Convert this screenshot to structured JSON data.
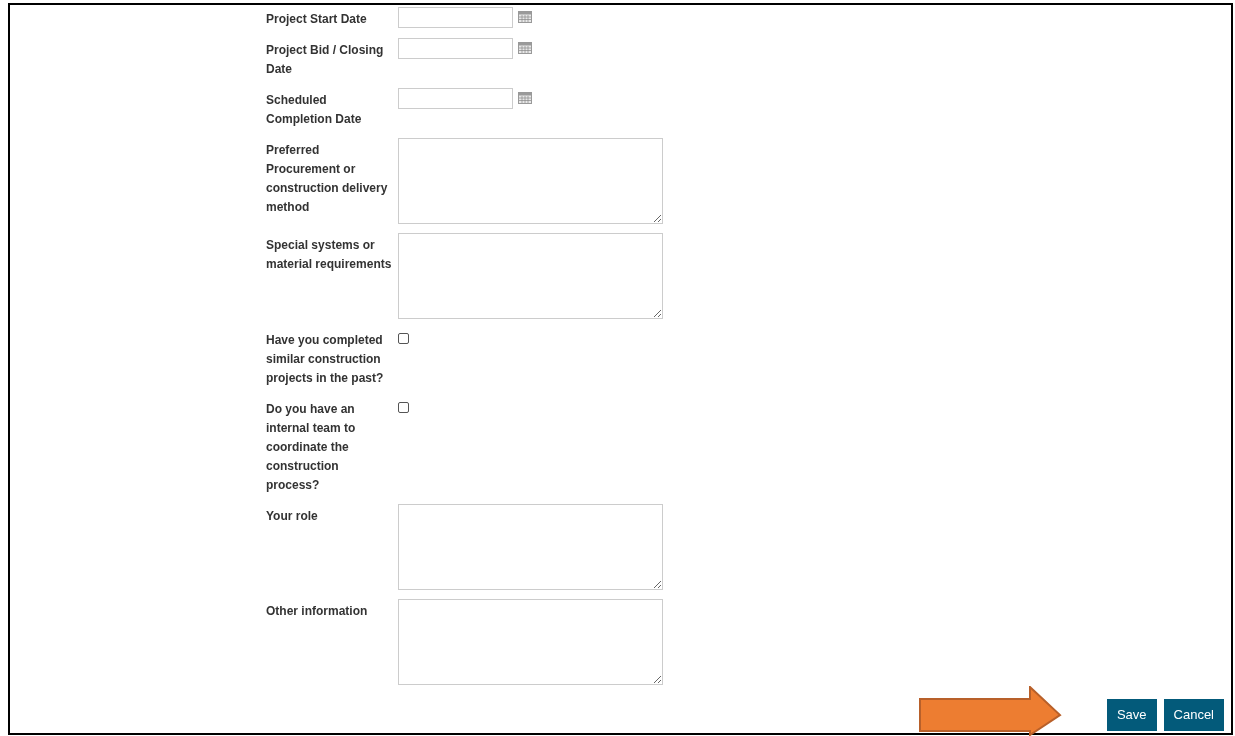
{
  "fields": [
    {
      "kind": "date",
      "label": "Project Start Date"
    },
    {
      "kind": "date",
      "label": "Project Bid / Closing Date"
    },
    {
      "kind": "date",
      "label": "Scheduled Completion Date"
    },
    {
      "kind": "textarea",
      "label": "Preferred Procurement or construction delivery method"
    },
    {
      "kind": "textarea",
      "label": "Special systems or material requirements"
    },
    {
      "kind": "checkbox",
      "label": "Have you completed similar construction projects in the past?",
      "checked": false
    },
    {
      "kind": "checkbox",
      "label": "Do you have an internal team to coordinate the construction process?",
      "checked": false
    },
    {
      "kind": "textarea",
      "label": "Your role"
    },
    {
      "kind": "textarea",
      "label": "Other information"
    }
  ],
  "buttons": [
    "Save",
    "Cancel"
  ]
}
